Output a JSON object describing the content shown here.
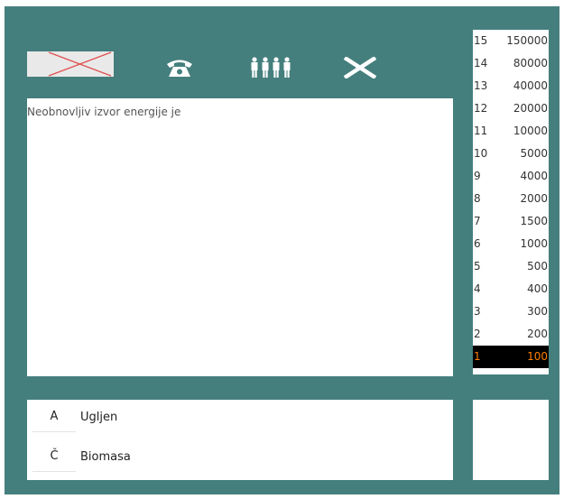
{
  "question": {
    "text": "Neobnovljiv izvor energije je"
  },
  "lifelines": [
    {
      "name": "fifty-fifty",
      "icon": "fifty-fifty-crossed-icon"
    },
    {
      "name": "phone",
      "icon": "phone-icon"
    },
    {
      "name": "audience",
      "icon": "audience-icon"
    },
    {
      "name": "quit",
      "icon": "close-icon"
    }
  ],
  "answers": [
    {
      "letter": "A",
      "text": "Ugljen"
    },
    {
      "letter": "Č",
      "text": "Biomasa"
    }
  ],
  "prize_ladder": [
    {
      "level": "15",
      "amount": "150000"
    },
    {
      "level": "14",
      "amount": "80000"
    },
    {
      "level": "13",
      "amount": "40000"
    },
    {
      "level": "12",
      "amount": "20000"
    },
    {
      "level": "11",
      "amount": "10000"
    },
    {
      "level": "10",
      "amount": "5000"
    },
    {
      "level": "9",
      "amount": "4000"
    },
    {
      "level": "8",
      "amount": "2000"
    },
    {
      "level": "7",
      "amount": "1500"
    },
    {
      "level": "6",
      "amount": "1000"
    },
    {
      "level": "5",
      "amount": "500"
    },
    {
      "level": "4",
      "amount": "400"
    },
    {
      "level": "3",
      "amount": "300"
    },
    {
      "level": "2",
      "amount": "200"
    },
    {
      "level": "1",
      "amount": "100",
      "current": true
    }
  ],
  "colors": {
    "frame": "#447f7d",
    "current_level_bg": "#000000",
    "current_level_text": "#ff7f00",
    "used_lifeline_cross": "#e05050"
  }
}
